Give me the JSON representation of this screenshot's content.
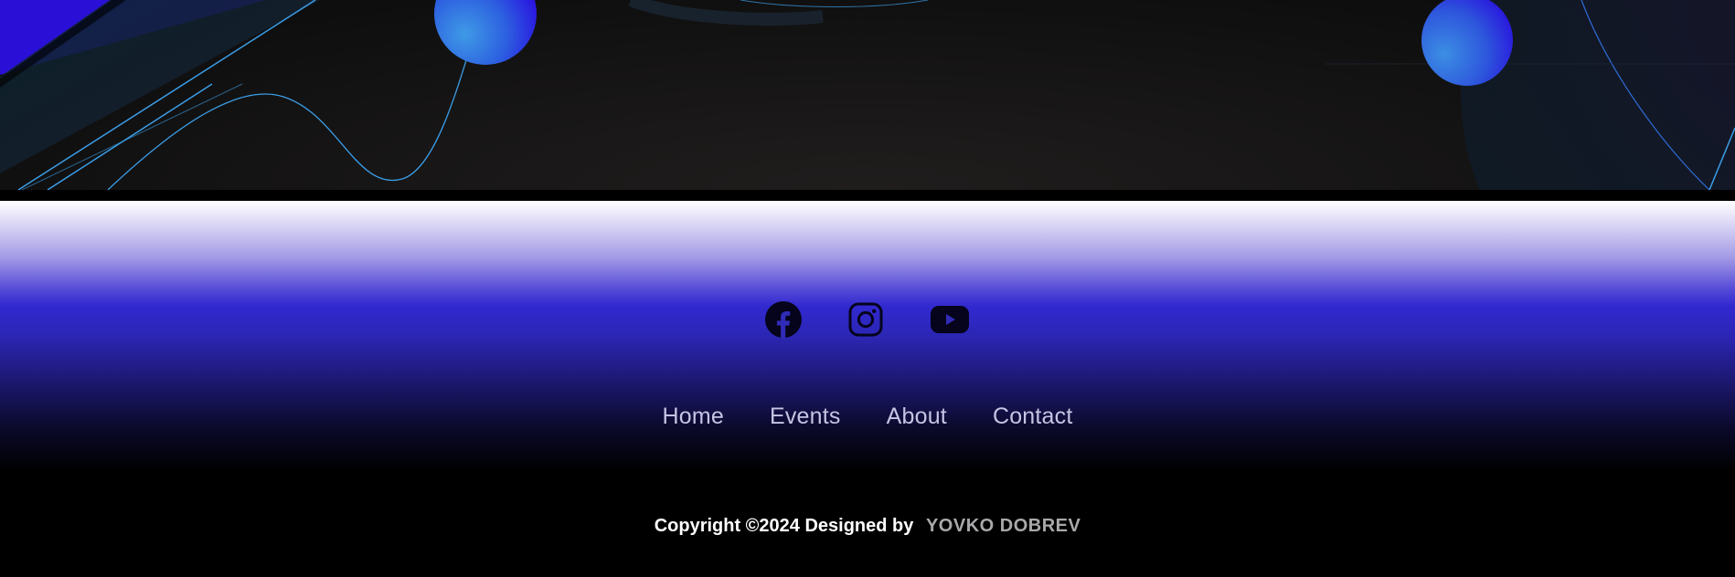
{
  "social": [
    {
      "name": "facebook-icon"
    },
    {
      "name": "instagram-icon"
    },
    {
      "name": "youtube-icon"
    }
  ],
  "nav": {
    "home": "Home",
    "events": "Events",
    "about": "About",
    "contact": "Contact"
  },
  "footer": {
    "copyright": "Copyright ©2024 Designed by",
    "author": "YOVKO DOBREV"
  },
  "colors": {
    "accent_blue": "#3128cf",
    "line_blue": "#3a9ee8",
    "background": "#000000"
  }
}
